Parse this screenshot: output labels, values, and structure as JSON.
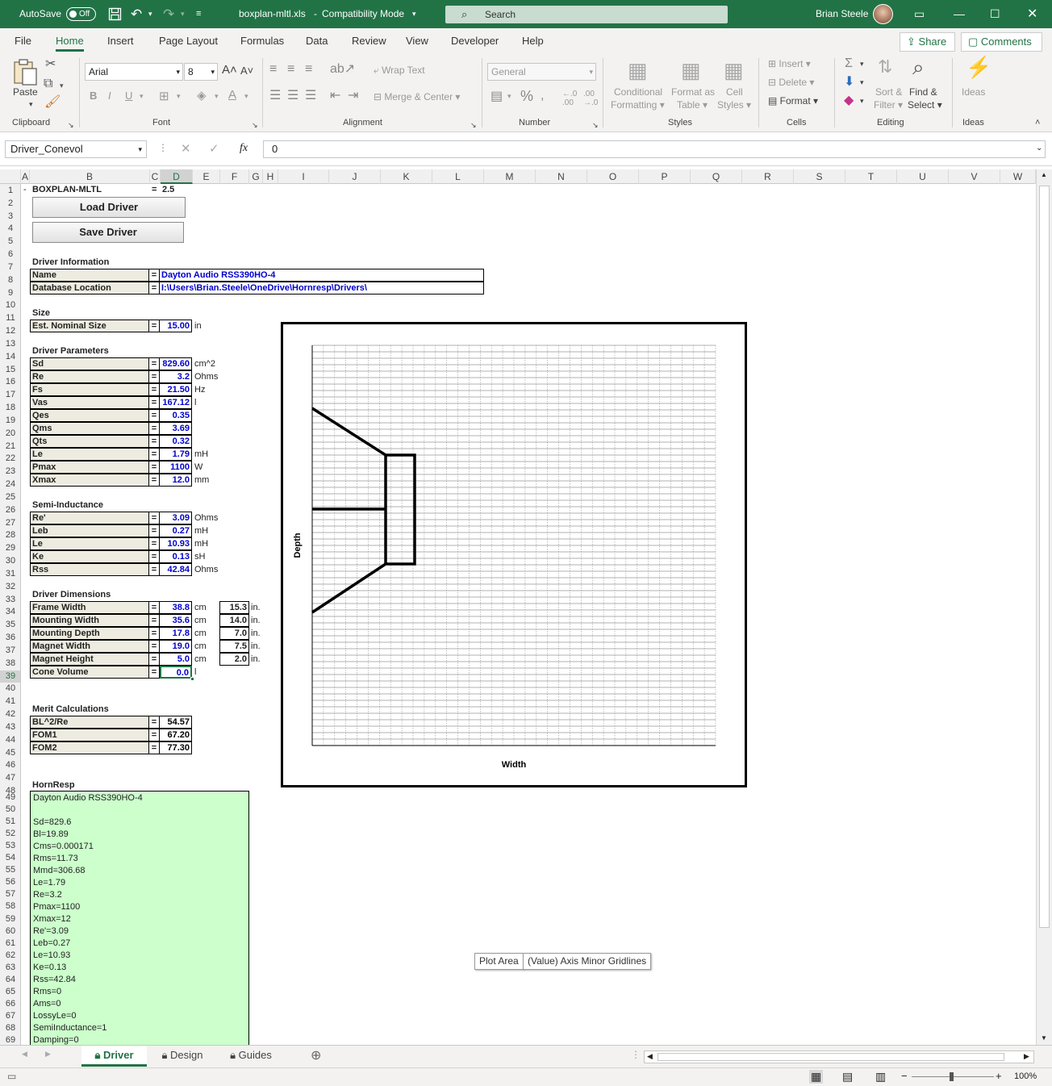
{
  "window": {
    "autosave_label": "AutoSave",
    "autosave_state": "Off",
    "filename": "boxplan-mltl.xls",
    "separator": "-",
    "mode": "Compatibility Mode",
    "search_placeholder": "Search",
    "user": "Brian Steele"
  },
  "menu": [
    "File",
    "Home",
    "Insert",
    "Page Layout",
    "Formulas",
    "Data",
    "Review",
    "View",
    "Developer",
    "Help"
  ],
  "share_label": "Share",
  "comments_label": "Comments",
  "ribbon": {
    "paste": "Paste",
    "font_name": "Arial",
    "font_size": "8",
    "bold": "B",
    "italic": "I",
    "underline": "U",
    "wrap_text": "Wrap Text",
    "merge_center": "Merge & Center",
    "number_format": "General",
    "conditional": "Conditional",
    "formatting": "Formatting",
    "format_as": "Format as",
    "table": "Table",
    "cell": "Cell",
    "styles": "Styles",
    "insert": "Insert",
    "delete": "Delete",
    "format": "Format",
    "sort": "Sort &",
    "filter": "Filter",
    "find": "Find &",
    "select": "Select",
    "ideas": "Ideas",
    "groups": {
      "clipboard": "Clipboard",
      "font": "Font",
      "alignment": "Alignment",
      "number": "Number",
      "styles": "Styles",
      "cells": "Cells",
      "editing": "Editing",
      "ideas": "Ideas"
    }
  },
  "formula_bar": {
    "name_box": "Driver_Conevol",
    "fx": "fx",
    "value": "0"
  },
  "columns": [
    "A",
    "B",
    "C",
    "D",
    "E",
    "F",
    "G",
    "H",
    "I",
    "J",
    "K",
    "L",
    "M",
    "N",
    "O",
    "P",
    "Q",
    "R",
    "S",
    "T",
    "U",
    "V",
    "W"
  ],
  "rows": [
    "1",
    "2",
    "3",
    "4",
    "5",
    "6",
    "7",
    "8",
    "9",
    "10",
    "11",
    "12",
    "13",
    "14",
    "15",
    "16",
    "17",
    "18",
    "19",
    "20",
    "21",
    "22",
    "23",
    "24",
    "25",
    "26",
    "27",
    "28",
    "29",
    "30",
    "31",
    "32",
    "33",
    "34",
    "35",
    "36",
    "37",
    "38",
    "39",
    "40",
    "41",
    "42",
    "43",
    "44",
    "45",
    "46",
    "47",
    "48",
    "49",
    "50",
    "51",
    "52",
    "53",
    "54",
    "55",
    "56",
    "57",
    "58",
    "59",
    "60",
    "61",
    "62",
    "63",
    "64",
    "65",
    "66",
    "67",
    "68",
    "69"
  ],
  "sheet": {
    "r1_dash": "-",
    "r1_title": "BOXPLAN-MLTL",
    "r1_eq": "=",
    "r1_version": "2.5",
    "load_driver": "Load Driver",
    "save_driver": "Save Driver",
    "driver_info_title": "Driver Information",
    "name_label": "Name",
    "name_value": "Dayton Audio RSS390HO-4",
    "db_label": "Database Location",
    "db_value": "I:\\Users\\Brian.Steele\\OneDrive\\Hornresp\\Drivers\\",
    "size_title": "Size",
    "size_label": "Est. Nominal Size",
    "size_value": "15.00",
    "size_unit": "in",
    "eq": "=",
    "params_title": "Driver Parameters",
    "params": [
      {
        "label": "Sd",
        "value": "829.60",
        "unit": "cm^2"
      },
      {
        "label": "Re",
        "value": "3.2",
        "unit": "Ohms"
      },
      {
        "label": "Fs",
        "value": "21.50",
        "unit": "Hz"
      },
      {
        "label": "Vas",
        "value": "167.12",
        "unit": "l"
      },
      {
        "label": "Qes",
        "value": "0.35",
        "unit": ""
      },
      {
        "label": "Qms",
        "value": "3.69",
        "unit": ""
      },
      {
        "label": "Qts",
        "value": "0.32",
        "unit": ""
      },
      {
        "label": "Le",
        "value": "1.79",
        "unit": "mH"
      },
      {
        "label": "Pmax",
        "value": "1100",
        "unit": "W"
      },
      {
        "label": "Xmax",
        "value": "12.0",
        "unit": "mm"
      }
    ],
    "semi_title": "Semi-Inductance",
    "semi": [
      {
        "label": "Re'",
        "value": "3.09",
        "unit": "Ohms"
      },
      {
        "label": "Leb",
        "value": "0.27",
        "unit": "mH"
      },
      {
        "label": "Le",
        "value": "10.93",
        "unit": "mH"
      },
      {
        "label": "Ke",
        "value": "0.13",
        "unit": "sH"
      },
      {
        "label": "Rss",
        "value": "42.84",
        "unit": "Ohms"
      }
    ],
    "dims_title": "Driver Dimensions",
    "dims": [
      {
        "label": "Frame Width",
        "value": "38.8",
        "unit": "cm",
        "in_value": "15.3",
        "in_unit": "in."
      },
      {
        "label": "Mounting Width",
        "value": "35.6",
        "unit": "cm",
        "in_value": "14.0",
        "in_unit": "in."
      },
      {
        "label": "Mounting Depth",
        "value": "17.8",
        "unit": "cm",
        "in_value": "7.0",
        "in_unit": "in."
      },
      {
        "label": "Magnet Width",
        "value": "19.0",
        "unit": "cm",
        "in_value": "7.5",
        "in_unit": "in."
      },
      {
        "label": "Magnet Height",
        "value": "5.0",
        "unit": "cm",
        "in_value": "2.0",
        "in_unit": "in."
      }
    ],
    "cone_label": "Cone Volume",
    "cone_value": "0.0",
    "cone_unit": "l",
    "merit_title": "Merit Calculations",
    "merit": [
      {
        "label": "BL^2/Re",
        "value": "54.57"
      },
      {
        "label": "FOM1",
        "value": "67.20"
      },
      {
        "label": "FOM2",
        "value": "77.30"
      }
    ],
    "hornresp_title": "HornResp",
    "hornresp_lines": [
      "Dayton Audio RSS390HO-4",
      "",
      "Sd=829.6",
      "Bl=19.89",
      "Cms=0.000171",
      "Rms=11.73",
      "Mmd=306.68",
      "Le=1.79",
      "Re=3.2",
      "Pmax=1100",
      "Xmax=12",
      "Re'=3.09",
      "Leb=0.27",
      "Le=10.93",
      "Ke=0.13",
      "Rss=42.84",
      "Rms=0",
      "Ams=0",
      "LossyLe=0",
      "SemiInductance=1",
      "Damping=0"
    ]
  },
  "chart": {
    "xlabel": "Width",
    "ylabel": "Depth"
  },
  "tooltips": [
    "Plot Area",
    "(Value) Axis Minor Gridlines"
  ],
  "tabs": [
    "Driver",
    "Design",
    "Guides"
  ],
  "status": {
    "zoom": "100%"
  },
  "colors": {
    "accent": "#217346",
    "value_blue": "#0000cc",
    "label_bg": "#eeece1",
    "hornresp_bg": "#ccffcc"
  }
}
